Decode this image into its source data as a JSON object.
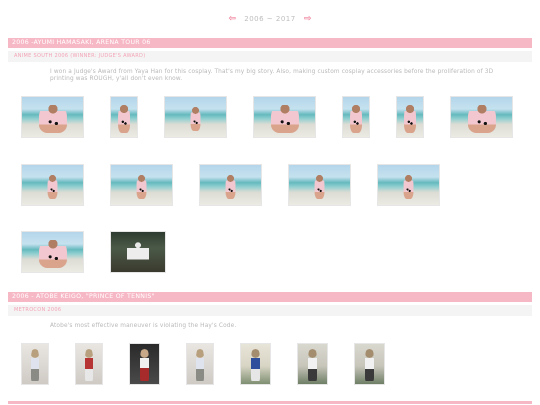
{
  "nav": {
    "prev_icon": "left-arrow-icon",
    "next_icon": "right-arrow-icon",
    "year_range": "2006 ~ 2017"
  },
  "sections": [
    {
      "title": "2006 -AYUMI HAMASAKI, ARENA TOUR 06",
      "subtitle": "ANIME SOUTH 2006 (WINNER: JUDGE'S AWARD)",
      "description": "I won a Judge's Award from Yaya Han for this cosplay. That's my big story. Also, making custom cosplay accessories before the proliferation of 3D printing was ROUGH, y'all don't even know."
    },
    {
      "title": "2006 - ATOBE KEIGO, \"PRINCE OF TENNIS\"",
      "subtitle": "METROCON 2006",
      "description": "Atobe's most effective maneuver is violating the Hay's Code."
    }
  ]
}
